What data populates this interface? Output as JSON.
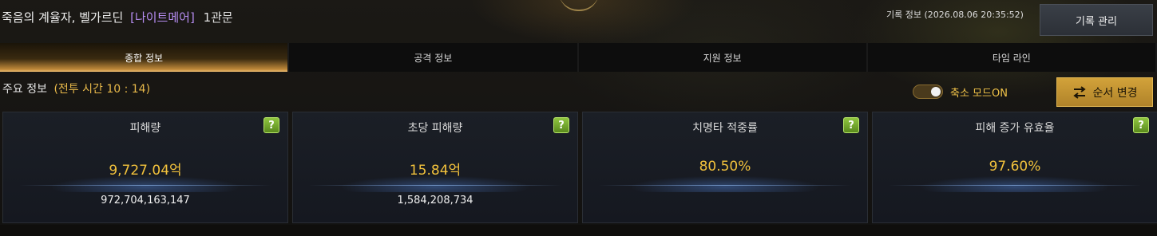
{
  "header": {
    "boss_name": "죽음의 계율자, 벨가르딘",
    "difficulty": "[나이트메어]",
    "gate": "1관문",
    "record_info": "기록 정보 (2026.08.06 20:35:52)",
    "record_manage_label": "기록 관리"
  },
  "tabs": [
    {
      "label": "종합 정보",
      "active": true
    },
    {
      "label": "공격 정보",
      "active": false
    },
    {
      "label": "지원 정보",
      "active": false
    },
    {
      "label": "타임 라인",
      "active": false
    }
  ],
  "summary": {
    "label": "주요 정보",
    "battle_time": "(전투 시간 10 : 14)"
  },
  "controls": {
    "compact_mode_label": "축소 모드ON",
    "compact_mode_on": true,
    "change_order_label": "순서 변경"
  },
  "cards": [
    {
      "title": "피해량",
      "value": "9,727.04억",
      "raw": "972,704,163,147"
    },
    {
      "title": "초당 피해량",
      "value": "15.84억",
      "raw": "1,584,208,734"
    },
    {
      "title": "치명타 적중률",
      "value": "80.50%",
      "raw": ""
    },
    {
      "title": "피해 증가 유효율",
      "value": "97.60%",
      "raw": ""
    }
  ],
  "help_glyph": "?",
  "colors": {
    "accent_gold": "#f2c23c",
    "difficulty_purple": "#b58cf0",
    "help_green": "#7cb334",
    "button_gold": "#c9982f"
  },
  "icons": {
    "help": "question-mark-icon",
    "order": "swap-arrows-icon"
  }
}
